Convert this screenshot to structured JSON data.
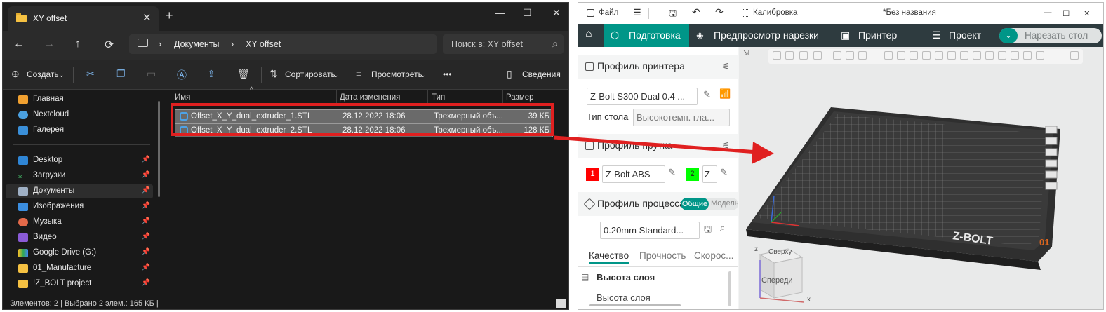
{
  "explorer": {
    "tab_title": "XY offset",
    "new_tab": "+",
    "window_controls": [
      "—",
      "☐",
      "✕"
    ],
    "nav": {
      "back": "←",
      "forward": "→",
      "up": "↑",
      "refresh": "⟳"
    },
    "address": {
      "separator": "›",
      "crumbs": [
        "Документы",
        "XY offset"
      ]
    },
    "search_placeholder": "Поиск в: XY offset",
    "toolbar": {
      "new_label": "Создать",
      "sort_label": "Сортировать",
      "view_label": "Просмотреть",
      "more_label": "•••",
      "details_label": "Сведения"
    },
    "sidebar": {
      "items": [
        {
          "label": "Главная",
          "pinned": false
        },
        {
          "label": "Nextcloud",
          "pinned": false
        },
        {
          "label": "Галерея",
          "pinned": false
        },
        {
          "label": "Desktop",
          "pinned": true
        },
        {
          "label": "Загрузки",
          "pinned": true
        },
        {
          "label": "Документы",
          "pinned": true
        },
        {
          "label": "Изображения",
          "pinned": true
        },
        {
          "label": "Музыка",
          "pinned": true
        },
        {
          "label": "Видео",
          "pinned": true
        },
        {
          "label": "Google Drive (G:)",
          "pinned": true
        },
        {
          "label": "01_Manufacture",
          "pinned": true
        },
        {
          "label": "!Z_BOLT project",
          "pinned": true
        }
      ]
    },
    "columns": [
      "Имя",
      "Дата изменения",
      "Тип",
      "Размер"
    ],
    "files": [
      {
        "name": "Offset_X_Y_dual_extruder_1.STL",
        "date": "28.12.2022 18:06",
        "type": "Трехмерный объ...",
        "size": "39 КБ"
      },
      {
        "name": "Offset_X_Y_dual_extruder_2.STL",
        "date": "28.12.2022 18:06",
        "type": "Трехмерный объ...",
        "size": "128 КБ"
      }
    ],
    "status": "Элементов: 2  |  Выбрано 2 элем.: 165 КБ  |"
  },
  "slicer": {
    "title_bar": {
      "file_label": "Файл",
      "calibration_label": "Калибровка",
      "document_title": "*Без названия",
      "window_controls": [
        "—",
        "☐",
        "✕"
      ]
    },
    "tabs": [
      "Подготовка",
      "Предпросмотр нарезки",
      "Принтер",
      "Проект"
    ],
    "slice_button": "Нарезать стол",
    "printer_profile": {
      "heading": "Профиль принтера",
      "printer": "Z-Bolt S300 Dual 0.4 ...",
      "bed_label": "Тип стола",
      "bed_value": "Высокотемп. гла..."
    },
    "filament_profile": {
      "heading": "Профиль прутка",
      "slots": [
        {
          "number": "1",
          "name": "Z-Bolt ABS",
          "color": "#ff0000"
        },
        {
          "number": "2",
          "name": "Z",
          "color": "#00ff00"
        }
      ]
    },
    "process_profile": {
      "heading": "Профиль процесса",
      "toggle_on": "Общие",
      "toggle_off": "Модель",
      "preset": "0.20mm Standard..."
    },
    "subtabs": [
      "Качество",
      "Прочность",
      "Скорос..."
    ],
    "quality": {
      "section": "Высота слоя",
      "field": "Высота слоя"
    },
    "viewport": {
      "bed_brand": "Z-BOLT",
      "plate_number": "01",
      "cube_top": "Сверху",
      "cube_front": "Спереди",
      "axis_x": "x",
      "axis_z": "z"
    }
  },
  "colors": {
    "explorer_bg": "#191919",
    "accent_teal": "#009688",
    "tab_bar": "#2e3b3f",
    "highlight_red": "#e02020"
  }
}
